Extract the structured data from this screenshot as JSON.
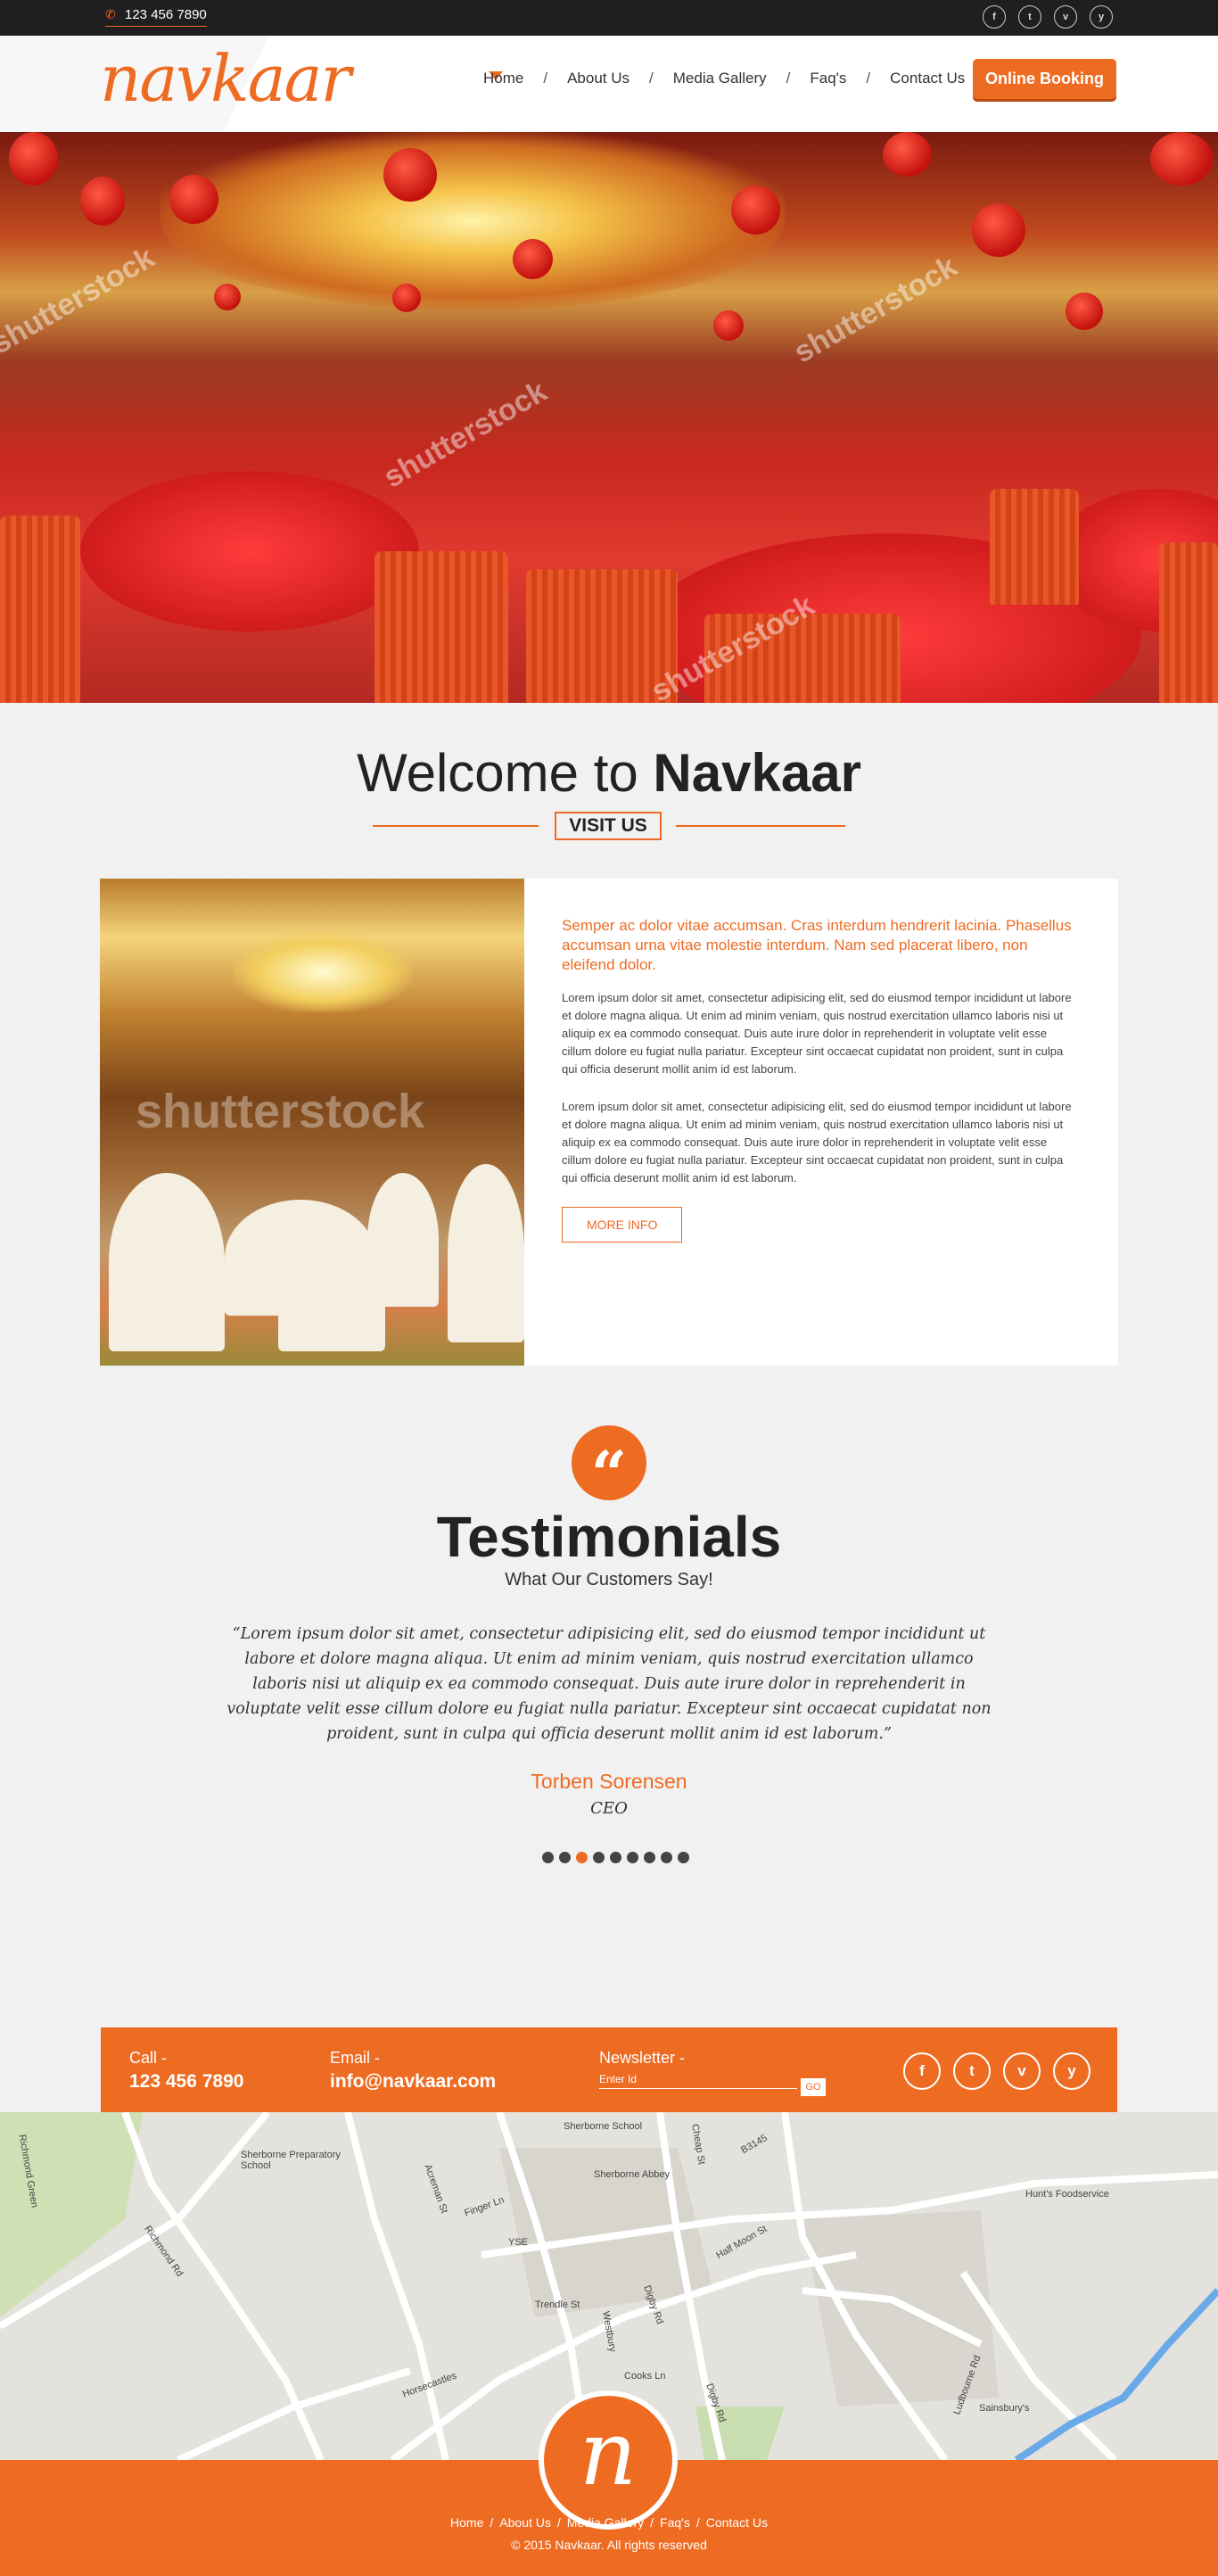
{
  "topbar": {
    "phone": "123 456 7890",
    "social": [
      "f",
      "t",
      "v",
      "y"
    ]
  },
  "header": {
    "logo": "navkaar",
    "nav": [
      "Home",
      "About Us",
      "Media Gallery",
      "Faq's",
      "Contact Us"
    ],
    "nav_sep": "/",
    "booking_label": "Online Booking"
  },
  "hero": {
    "watermark": "shutterstock"
  },
  "welcome": {
    "title_prefix": "Welcome to ",
    "title_brand": "Navkaar",
    "visit_label": "VISIT US"
  },
  "about": {
    "image_watermark": "shutterstock",
    "lead": "Semper ac dolor vitae accumsan. Cras interdum hendrerit lacinia. Phasellus accumsan urna vitae molestie interdum. Nam sed placerat libero, non eleifend dolor.",
    "para1": "Lorem ipsum dolor sit amet, consectetur adipisicing elit, sed do eiusmod tempor incididunt ut labore et dolore magna aliqua. Ut enim ad minim veniam, quis nostrud exercitation ullamco laboris nisi ut aliquip ex ea commodo consequat. Duis aute irure dolor in reprehenderit in voluptate velit esse cillum dolore eu fugiat nulla pariatur. Excepteur sint occaecat cupidatat non proident, sunt in culpa qui officia deserunt mollit anim id est laborum.",
    "para2": "Lorem ipsum dolor sit amet, consectetur adipisicing elit, sed do eiusmod tempor incididunt ut labore et dolore magna aliqua. Ut enim ad minim veniam, quis nostrud exercitation ullamco laboris nisi ut aliquip ex ea commodo consequat. Duis aute irure dolor in reprehenderit in voluptate velit esse cillum dolore eu fugiat nulla pariatur. Excepteur sint occaecat cupidatat non proident, sunt in culpa qui officia deserunt mollit anim id est laborum.",
    "more_label": "MORE INFO"
  },
  "testimonials": {
    "quote_mark": "“",
    "title": "Testimonials",
    "subtitle": "What Our Customers Say!",
    "quote": "“Lorem ipsum dolor sit amet, consectetur adipisicing elit, sed do eiusmod tempor incididunt ut labore et dolore magna aliqua. Ut enim ad minim veniam, quis nostrud exercitation ullamco laboris nisi ut aliquip ex ea commodo consequat. Duis aute irure dolor in reprehenderit in voluptate velit esse cillum dolore eu fugiat nulla pariatur. Excepteur sint occaecat cupidatat non proident, sunt in culpa qui officia deserunt mollit anim id est laborum.”",
    "name": "Torben Sorensen",
    "role": "CEO",
    "slide_count": 9,
    "active_slide": 3
  },
  "contact": {
    "call_label": "Call -",
    "call_value": "123 456 7890",
    "email_label": "Email -",
    "email_value": "info@navkaar.com",
    "newsletter_label": "Newsletter -",
    "newsletter_placeholder": "Enter Id",
    "go_label": "GO",
    "social": [
      "f",
      "t",
      "v",
      "y"
    ]
  },
  "map": {
    "labels": [
      "Sherborne School",
      "Sherborne Preparatory School",
      "Sherborne Abbey",
      "Hunt's Foodservice",
      "YSE",
      "Richmond Rd",
      "Richmond Green",
      "Acreman St",
      "Finger Ln",
      "Trendle St",
      "Cheap St",
      "Digby Rd",
      "Half Moon St",
      "Cooks Ln",
      "Westbury",
      "Horsecastles",
      "Ludbourne Rd",
      "Sainsbury's",
      "B3145",
      "Digby Rd"
    ]
  },
  "footer": {
    "logo": "n",
    "nav": [
      "Home",
      "About Us",
      "Media Gallery",
      "Faq's",
      "Contact Us"
    ],
    "sep": "/",
    "copyright": "© 2015 Navkaar. All rights reserved"
  },
  "colors": {
    "accent": "#ee6b22",
    "topbar": "#1f1f1f",
    "background": "#f1f1f1"
  }
}
